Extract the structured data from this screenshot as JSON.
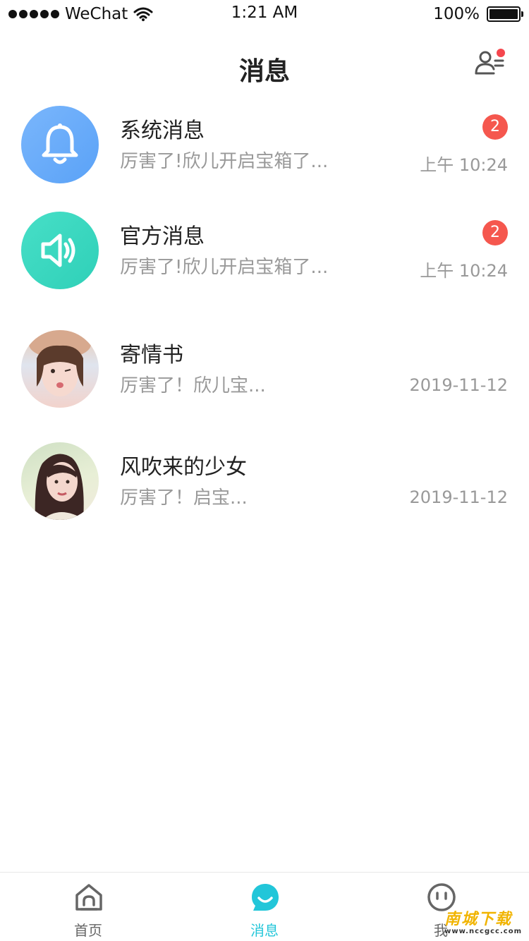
{
  "status_bar": {
    "carrier": "WeChat",
    "time": "1:21 AM",
    "battery": "100%",
    "battery_level": 1.0
  },
  "header": {
    "title": "消息",
    "contacts_icon": "contacts-icon",
    "notification_dot_color": "#f5474e"
  },
  "messages": [
    {
      "name": "系统消息",
      "preview": "厉害了!欣儿开启宝箱了...",
      "time": "上午 10:24",
      "badge": "2",
      "avatar": "bell-icon",
      "avatar_color": "#6aaefa"
    },
    {
      "name": "官方消息",
      "preview": "厉害了!欣儿开启宝箱了...",
      "time": "上午 10:24",
      "badge": "2",
      "avatar": "speaker-icon",
      "avatar_color": "#3fd8c0"
    },
    {
      "name": "寄情书",
      "preview": "厉害了！欣儿宝...",
      "time": "2019-11-12",
      "badge": "",
      "avatar": "user-avatar"
    },
    {
      "name": "风吹来的少女",
      "preview": "厉害了！启宝...",
      "time": "2019-11-12",
      "badge": "",
      "avatar": "user-avatar"
    }
  ],
  "tab_bar": {
    "tabs": [
      {
        "label": "首页",
        "icon": "home-icon",
        "active": false
      },
      {
        "label": "消息",
        "icon": "message-icon",
        "active": true
      },
      {
        "label": "我",
        "icon": "profile-icon",
        "active": false
      }
    ],
    "active_color": "#22c6d9"
  },
  "watermark": {
    "text": "南城下载",
    "url_text": "www.nccgcc.com"
  }
}
